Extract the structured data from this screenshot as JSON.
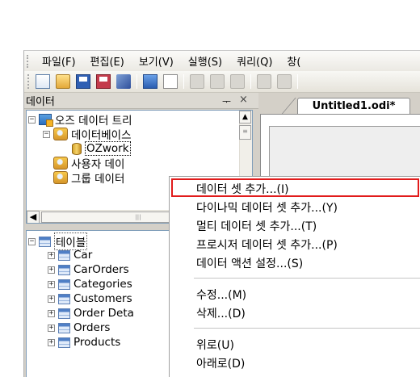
{
  "menubar": {
    "items": [
      "파일(F)",
      "편집(E)",
      "보기(V)",
      "실행(S)",
      "쿼리(Q)",
      "창("
    ]
  },
  "toolbar": {
    "icons": [
      "new-report-icon",
      "open-folder-icon",
      "save-icon",
      "save-all-icon",
      "edit-pen-icon",
      "database-icon",
      "properties-icon",
      "cut-icon",
      "copy-icon",
      "paste-icon",
      "undo-icon",
      "redo-icon"
    ]
  },
  "data_panel": {
    "title": "데이터",
    "pin_glyph": "ᅮ",
    "close_glyph": "×",
    "tree": {
      "root": "오즈 데이터 트리",
      "database": "데이터베이스",
      "connection": "OZwork",
      "user_data": "사용자 데이",
      "group_data": "그룹 데이터"
    },
    "tables": {
      "root": "테이블",
      "items": [
        "Car",
        "CarOrders",
        "Categories",
        "Customers",
        "Order Deta",
        "Orders",
        "Products"
      ]
    },
    "scroll_glyphs": {
      "up": "▲",
      "grip": "≡",
      "left": "◀",
      "hgrip": "|||"
    }
  },
  "editor": {
    "tab_label": "Untitled1.odi*"
  },
  "context_menu": {
    "items": [
      "데이터 셋 추가...(I)",
      "다이나믹 데이터 셋 추가...(Y)",
      "멀티 데이터 셋 추가...(T)",
      "프로시저 데이터 셋 추가...(P)",
      "데이터 액션 설정...(S)",
      "수정...(M)",
      "삭제...(D)",
      "위로(U)",
      "아래로(D)"
    ],
    "highlight_color": "#e11b1b"
  }
}
